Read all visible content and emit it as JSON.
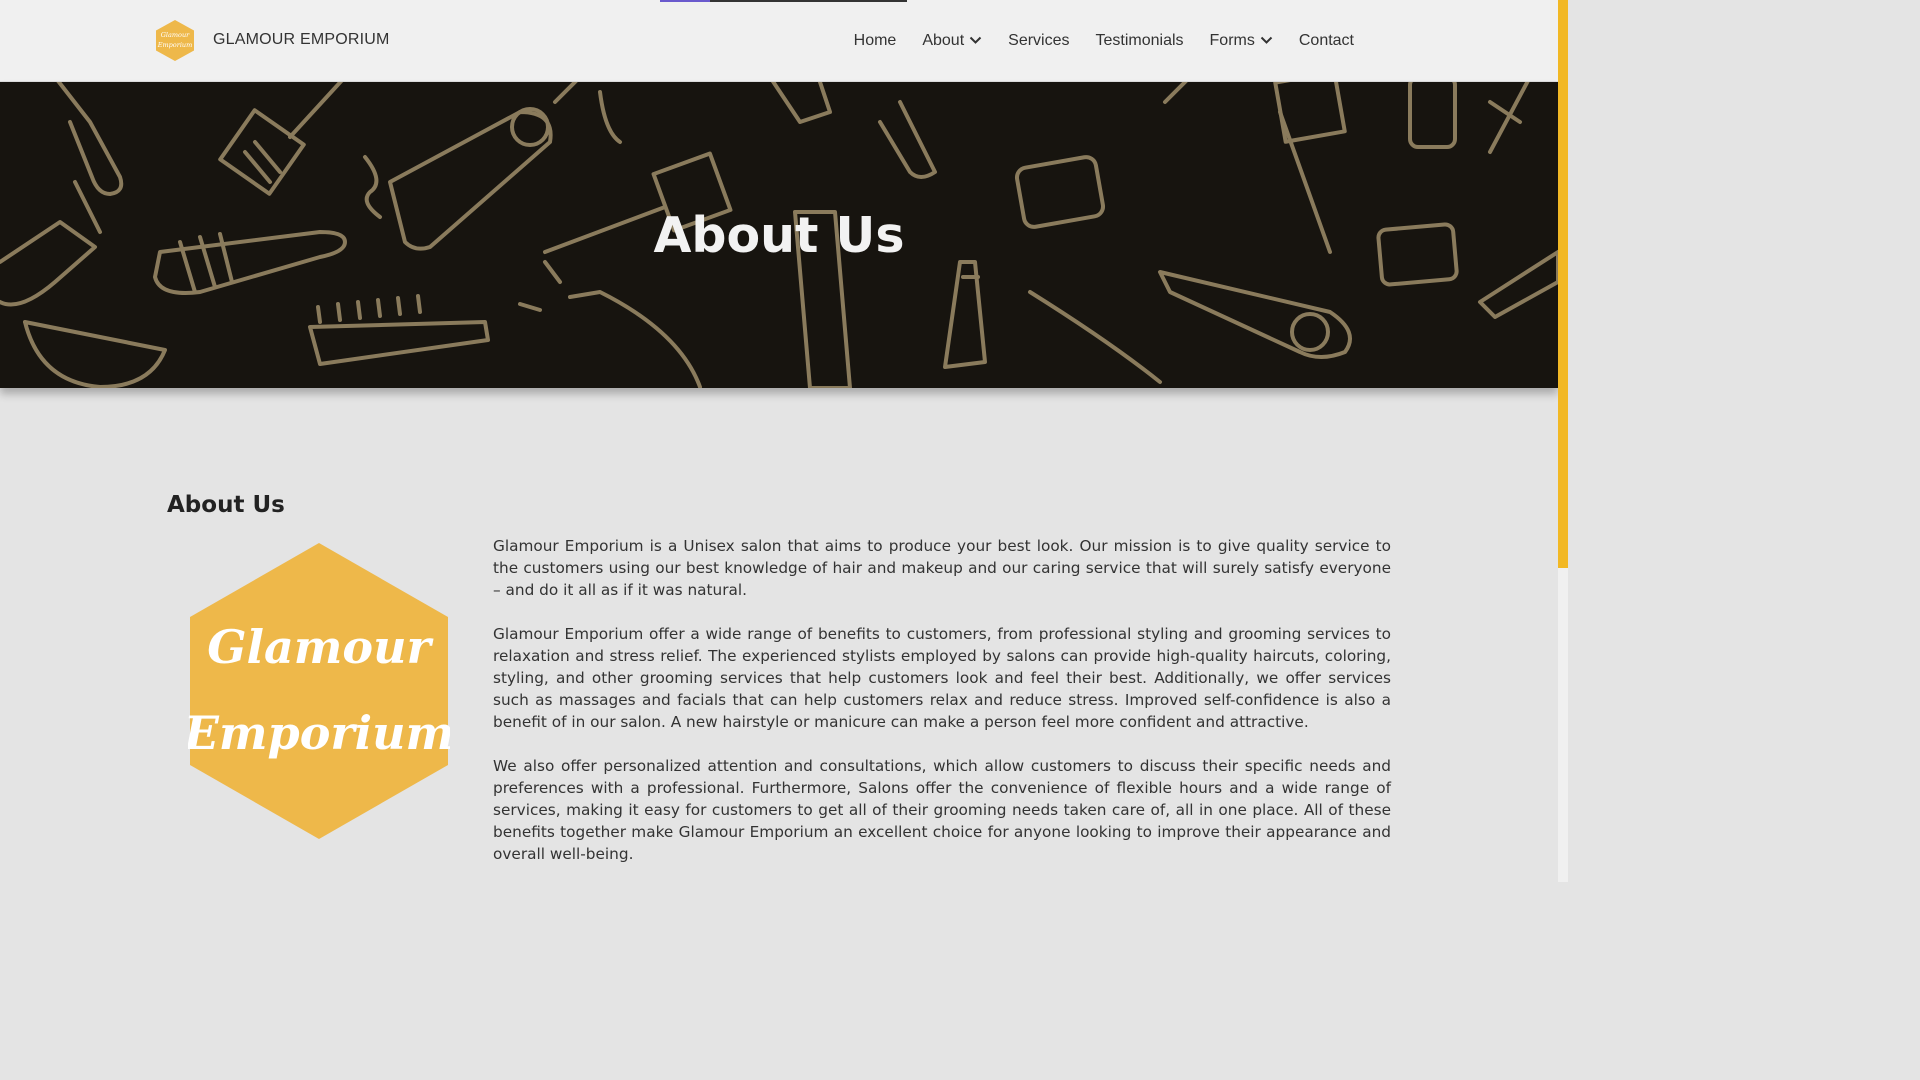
{
  "brand": {
    "name": "GLAMOUR EMPORIUM",
    "logo_text_line1": "Glamour",
    "logo_text_line2": "Emporium"
  },
  "nav": {
    "items": [
      {
        "label": "Home",
        "dropdown": false
      },
      {
        "label": "About",
        "dropdown": true
      },
      {
        "label": "Services",
        "dropdown": false
      },
      {
        "label": "Testimonials",
        "dropdown": false
      },
      {
        "label": "Forms",
        "dropdown": true
      },
      {
        "label": "Contact",
        "dropdown": false
      }
    ]
  },
  "hero": {
    "title": "About Us"
  },
  "section": {
    "heading": "About Us",
    "paragraphs": [
      "Glamour Emporium is a Unisex salon that aims to produce your best look. Our mission is to give quality service to the customers using our best knowledge of hair and makeup and our caring service that will surely satisfy everyone – and do it all as if it was natural.",
      "Glamour Emporium offer a wide range of benefits to customers, from professional styling and grooming services to relaxation and stress relief. The experienced stylists employed by salons can provide high-quality haircuts, coloring, styling, and other grooming services that help customers look and feel their best. Additionally, we offer services such as massages and facials that can help customers relax and reduce stress. Improved self-confidence is also a benefit of in our salon. A new hairstyle or manicure can make a person feel more confident and attractive.",
      "We also offer personalized attention and consultations, which allow customers to discuss their specific needs and preferences with a professional. Furthermore, Salons offer the convenience of flexible hours and a wide range of services, making it easy for customers to get all of their grooming needs taken care of, all in one place. All of these benefits together make Glamour Emporium an excellent choice for anyone looking to improve their appearance and overall well-being."
    ]
  },
  "colors": {
    "accent": "#f2b824",
    "logo": "#eeb84a",
    "hero_bg": "#17140f",
    "pattern": "#8a7b5c"
  },
  "icons": [
    "chevron-down-icon",
    "brand-logo"
  ]
}
